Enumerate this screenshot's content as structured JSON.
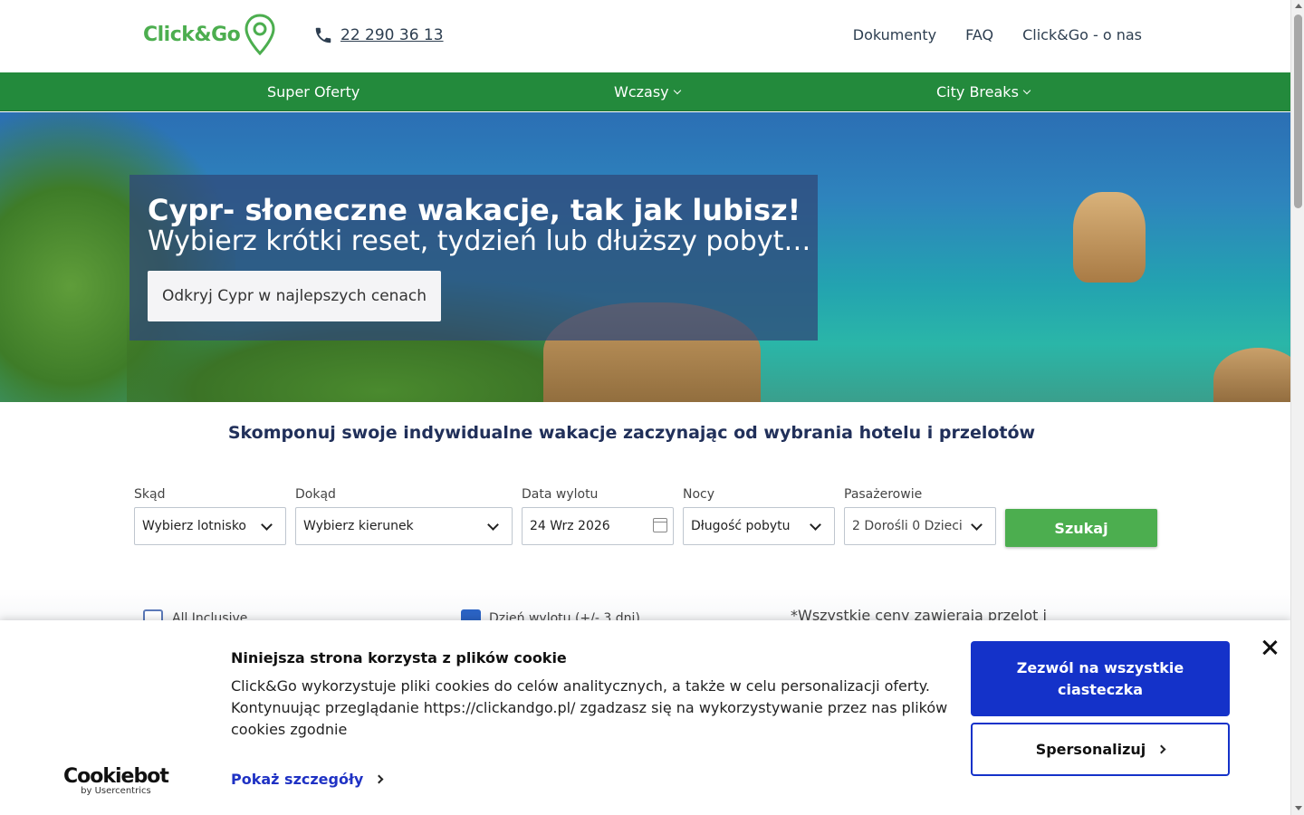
{
  "header": {
    "logo_text": "Click&Go",
    "phone": "22 290 36 13",
    "links": [
      "Dokumenty",
      "FAQ",
      "Click&Go - o nas"
    ]
  },
  "nav": {
    "items": [
      "Super Oferty",
      "Wczasy",
      "City Breaks"
    ]
  },
  "hero": {
    "title": "Cypr- słoneczne wakacje, tak jak lubisz!",
    "subtitle": "Wybierz krótki reset, tydzień lub dłuższy pobyt…",
    "cta": "Odkryj Cypr w najlepszych cenach"
  },
  "search": {
    "title": "Skomponuj swoje indywidualne wakacje zaczynając od wybrania hotelu i przelotów",
    "from": {
      "label": "Skąd",
      "value": "Wybierz lotnisko"
    },
    "to": {
      "label": "Dokąd",
      "value": "Wybierz kierunek"
    },
    "date": {
      "label": "Data wylotu",
      "value": "24 Wrz 2026"
    },
    "nights": {
      "label": "Nocy",
      "value": "Długość pobytu"
    },
    "pax": {
      "label": "Pasażerowie",
      "value": "2 Dorośli 0 Dzieci"
    },
    "button": "Szukaj"
  },
  "filters": {
    "all_inclusive": "All Inclusive",
    "flex_date": "Dzień wylotu (+/- 3 dni)",
    "price_note": "*Wszystkie ceny zawierają przelot i"
  },
  "cookie": {
    "heading": "Niniejsza strona korzysta z plików cookie",
    "body": "Click&Go wykorzystuje pliki cookies do celów analitycznych, a także w celu personalizacji oferty. Kontynuując przeglądanie https://clickandgo.pl/ zgadzasz się na wykorzystywanie przez nas plików cookies zgodnie",
    "details_link": "Pokaż szczegóły",
    "allow_all": "Zezwól na wszystkie ciasteczka",
    "customize": "Spersonalizuj",
    "brand": "Cookiebot",
    "brand_by": "by Usercentrics"
  },
  "colors": {
    "brand_green": "#4cae4f",
    "nav_green": "#238a3c",
    "cookie_blue": "#1432c9",
    "title_navy": "#21305a"
  }
}
